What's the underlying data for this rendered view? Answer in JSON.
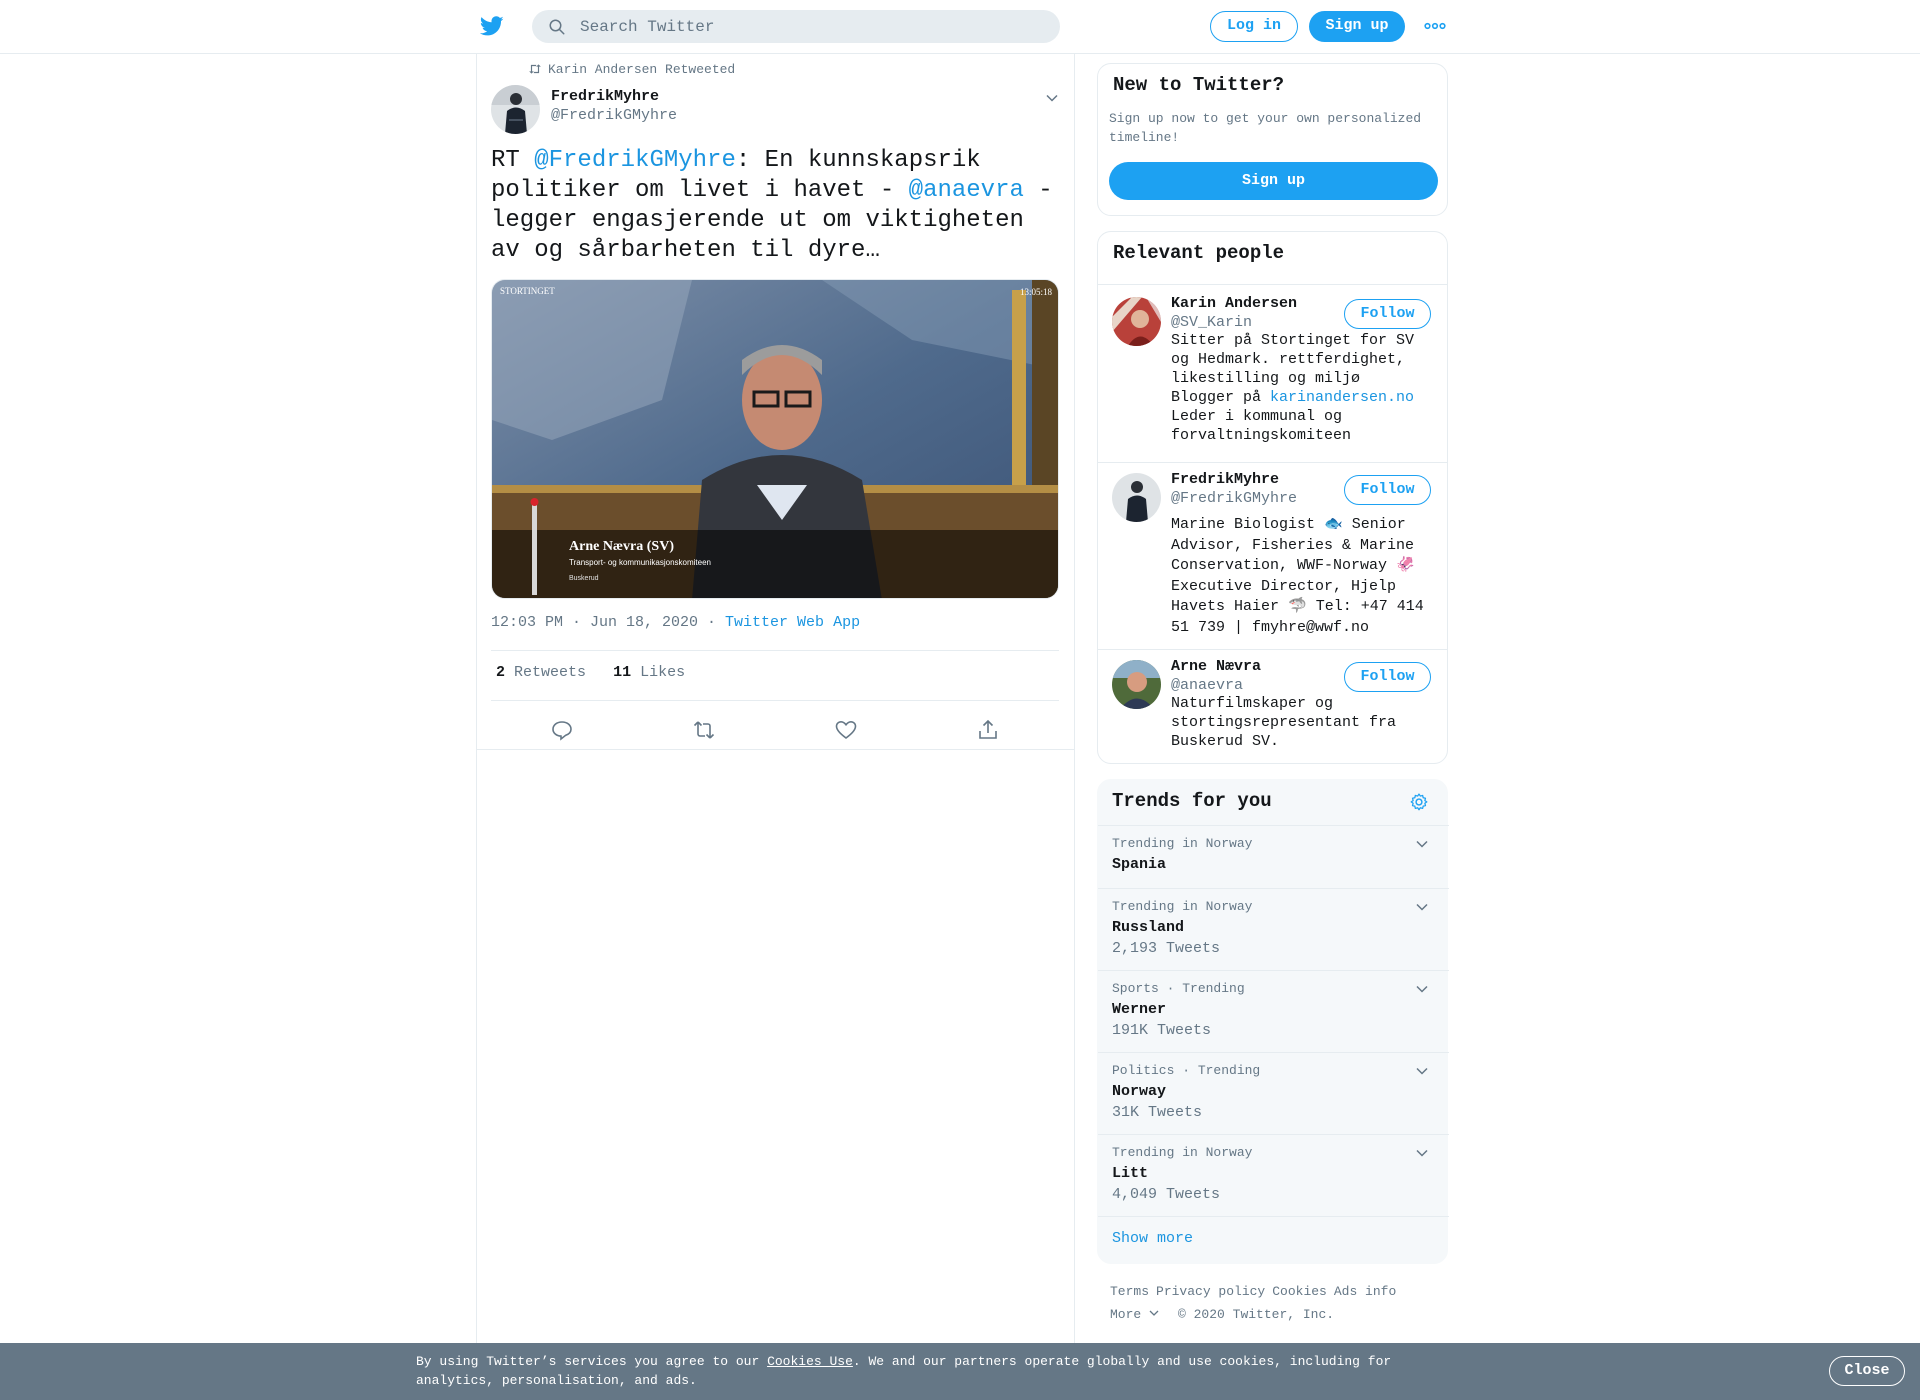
{
  "header": {
    "search_placeholder": "Search Twitter",
    "login_label": "Log in",
    "signup_label": "Sign up"
  },
  "tweet": {
    "retweet_context": "Karin Andersen Retweeted",
    "author_name": "FredrikMyhre",
    "author_handle": "@FredrikGMyhre",
    "text_parts": {
      "p1": "RT ",
      "mention1": "@FredrikGMyhre",
      "p2": ": En kunnskapsrik politiker om livet i havet - ",
      "mention2": "@anaevra",
      "p3": " - legger engasjerende ut om viktigheten av og sårbarheten til dyre…"
    },
    "media": {
      "channel": "STORTINGET",
      "clock": "13:05:18",
      "speaker_name": "Arne Nævra (SV)",
      "speaker_role": "Transport- og kommunikasjonskomiteen",
      "speaker_region": "Buskerud"
    },
    "time": "12:03 PM · Jun 18, 2020 · ",
    "source": "Twitter Web App",
    "retweets_count": "2",
    "retweets_label": "Retweets",
    "likes_count": "11",
    "likes_label": "Likes"
  },
  "sidebar": {
    "new_card": {
      "title": "New to Twitter?",
      "desc": "Sign up now to get your own personalized timeline!",
      "button": "Sign up"
    },
    "people": {
      "title": "Relevant people",
      "follow_label": "Follow",
      "items": [
        {
          "name": "Karin Andersen",
          "handle": "@SV_Karin",
          "bio_lines": [
            "Sitter på Stortinget for SV",
            "og Hedmark. rettferdighet,",
            "likestilling og miljø",
            "Blogger på "
          ],
          "bio_link": "karinandersen.no",
          "bio_lines2": [
            "Leder i kommunal og",
            "forvaltningskomiteen"
          ]
        },
        {
          "name": "FredrikMyhre",
          "handle": "@FredrikGMyhre",
          "bio": "Marine Biologist 🐟 Senior Advisor, Fisheries & Marine Conservation, WWF-Norway 🦑 Executive Director, Hjelp Havets Haier 🦈 Tel: +47 414 51 739 | fmyhre@wwf.no"
        },
        {
          "name": "Arne Nævra",
          "handle": "@anaevra",
          "bio": "Naturfilmskaper og stortingsrepresentant fra Buskerud SV."
        }
      ]
    },
    "trends": {
      "title": "Trends for you",
      "items": [
        {
          "context": "Trending in Norway",
          "name": "Spania",
          "count": ""
        },
        {
          "context": "Trending in Norway",
          "name": "Russland",
          "count": "2,193 Tweets"
        },
        {
          "context": "Sports · Trending",
          "name": "Werner",
          "count": "191K Tweets"
        },
        {
          "context": "Politics · Trending",
          "name": "Norway",
          "count": "31K Tweets"
        },
        {
          "context": "Trending in Norway",
          "name": "Litt",
          "count": "4,049 Tweets"
        }
      ],
      "show_more": "Show more"
    },
    "footer": {
      "terms": "Terms",
      "privacy": "Privacy policy",
      "cookies": "Cookies",
      "ads": "Ads info",
      "more": "More",
      "copyright": "© 2020 Twitter, Inc."
    }
  },
  "cookie_bar": {
    "text_before": "By using Twitter’s services you agree to our ",
    "link": "Cookies Use",
    "text_after": ". We and our partners operate globally and use cookies, including for analytics, personalisation, and ads.",
    "close_label": "Close"
  },
  "colors": {
    "accent": "#1da1f2",
    "link": "#1b95e0",
    "secondary_text": "#657786",
    "cookie_bar": "#657786"
  }
}
